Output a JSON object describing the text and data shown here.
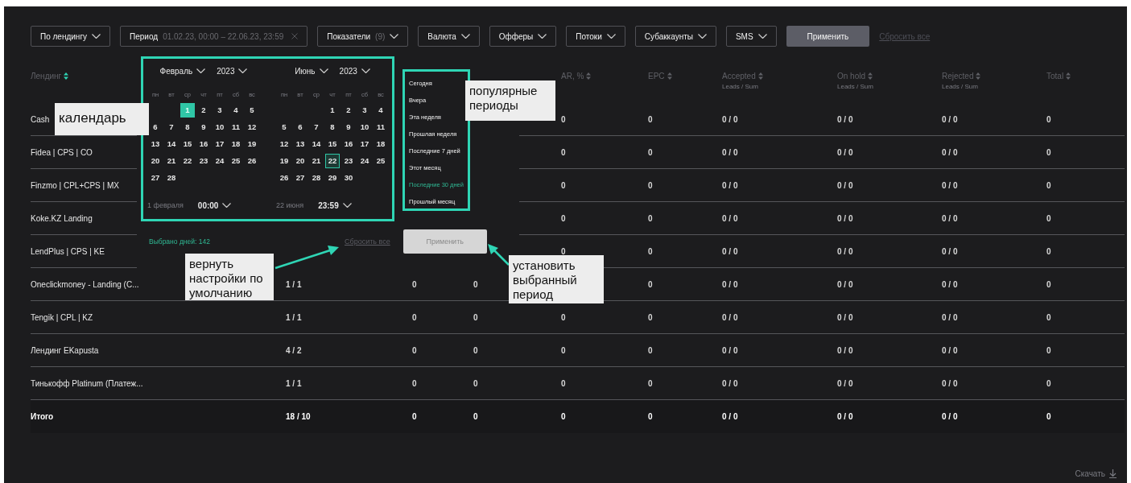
{
  "filters": [
    {
      "kind": "dropdown",
      "label": "По лендингу"
    },
    {
      "kind": "period",
      "label": "Период",
      "value": "01.02.23, 00:00 – 22.06.23, 23:59"
    },
    {
      "kind": "count",
      "label": "Показатели",
      "count": "(9)"
    },
    {
      "kind": "dropdown",
      "label": "Валюта"
    },
    {
      "kind": "dropdown",
      "label": "Офферы"
    },
    {
      "kind": "dropdown",
      "label": "Потоки"
    },
    {
      "kind": "dropdown",
      "label": "Субаккаунты"
    },
    {
      "kind": "dropdown",
      "label": "SMS"
    }
  ],
  "apply_button": "Применить",
  "reset_link": "Сбросить все",
  "table": {
    "columns": [
      {
        "kind": "header",
        "label": "Лендинг",
        "sort_active": true
      },
      {
        "kind": "covered"
      },
      {
        "kind": "covered"
      },
      {
        "kind": "covered"
      },
      {
        "kind": "header",
        "label": "AR, %",
        "sort_active": false
      },
      {
        "kind": "header",
        "label": "EPC",
        "sort_active": false
      },
      {
        "kind": "header",
        "label": "Accepted",
        "sublabel": "Leads / Sum",
        "sort_active": false
      },
      {
        "kind": "header",
        "label": "On hold",
        "sublabel": "Leads / Sum",
        "sort_active": false
      },
      {
        "kind": "header",
        "label": "Rejected",
        "sublabel": "Leads / Sum",
        "sort_active": false
      },
      {
        "kind": "header",
        "label": "Total",
        "sort_active": false
      }
    ],
    "rows": [
      {
        "kind": "full",
        "cells": [
          "Cash",
          "",
          "",
          "",
          "0",
          "0",
          "0 / 0",
          "0 / 0",
          "0 / 0",
          "0"
        ]
      },
      {
        "kind": "full",
        "cells": [
          "Fidea | CPS | CO",
          "",
          "",
          "",
          "0",
          "0",
          "0 / 0",
          "0 / 0",
          "0 / 0",
          "0"
        ]
      },
      {
        "kind": "full",
        "cells": [
          "Finzmo | CPL+CPS | MX",
          "",
          "",
          "",
          "0",
          "0",
          "0 / 0",
          "0 / 0",
          "0 / 0",
          "0"
        ]
      },
      {
        "kind": "full",
        "cells": [
          "Koke.KZ Landing",
          "",
          "",
          "",
          "0",
          "0",
          "0 / 0",
          "0 / 0",
          "0 / 0",
          "0"
        ]
      },
      {
        "kind": "full",
        "cells": [
          "LendPlus | CPS | KE",
          "",
          "",
          "",
          "0",
          "0",
          "0 / 0",
          "0 / 0",
          "0 / 0",
          "0"
        ]
      },
      {
        "kind": "full",
        "cells": [
          "Oneclickmoney - Landing (C...",
          "1 / 1",
          "0",
          "0",
          "",
          "0",
          "0 / 0",
          "0 / 0",
          "0 / 0",
          "0"
        ]
      },
      {
        "kind": "full",
        "cells": [
          "Tengik | CPL | KZ",
          "1 / 1",
          "0",
          "0",
          "0",
          "0",
          "0 / 0",
          "0 / 0",
          "0 / 0",
          "0"
        ]
      },
      {
        "kind": "full",
        "cells": [
          "Лендинг EKapusta",
          "4 / 2",
          "0",
          "0",
          "0",
          "0",
          "0 / 0",
          "0 / 0",
          "0 / 0",
          "0"
        ]
      },
      {
        "kind": "full",
        "cells": [
          "Тинькофф Platinum (Платеж...",
          "1 / 1",
          "0",
          "0",
          "0",
          "0",
          "0 / 0",
          "0 / 0",
          "0 / 0",
          "0"
        ]
      },
      {
        "kind": "total",
        "cells": [
          "Итого",
          "18 / 10",
          "0",
          "0",
          "0",
          "0",
          "0 / 0",
          "0 / 0",
          "0 / 0",
          "0"
        ]
      }
    ]
  },
  "date_picker": {
    "months": [
      {
        "month": "Февраль",
        "year": "2023",
        "first_week_starts_midweek": true,
        "weekdays": [
          "пн",
          "вт",
          "ср",
          "чт",
          "пт",
          "сб",
          "вс"
        ],
        "weeks": [
          {
            "days": [
              {
                "d": "1",
                "selected": true,
                "today": false
              },
              {
                "d": "2",
                "selected": false,
                "today": false
              },
              {
                "d": "3",
                "selected": false,
                "today": false
              },
              {
                "d": "4",
                "selected": false,
                "today": false
              },
              {
                "d": "5",
                "selected": false,
                "today": false
              }
            ]
          },
          {
            "days": [
              {
                "d": "6",
                "selected": false,
                "today": false
              },
              {
                "d": "7",
                "selected": false,
                "today": false
              },
              {
                "d": "8",
                "selected": false,
                "today": false
              },
              {
                "d": "9",
                "selected": false,
                "today": false
              },
              {
                "d": "10",
                "selected": false,
                "today": false
              },
              {
                "d": "11",
                "selected": false,
                "today": false
              },
              {
                "d": "12",
                "selected": false,
                "today": false
              }
            ]
          },
          {
            "days": [
              {
                "d": "13",
                "selected": false,
                "today": false
              },
              {
                "d": "14",
                "selected": false,
                "today": false
              },
              {
                "d": "15",
                "selected": false,
                "today": false
              },
              {
                "d": "16",
                "selected": false,
                "today": false
              },
              {
                "d": "17",
                "selected": false,
                "today": false
              },
              {
                "d": "18",
                "selected": false,
                "today": false
              },
              {
                "d": "19",
                "selected": false,
                "today": false
              }
            ]
          },
          {
            "days": [
              {
                "d": "20",
                "selected": false,
                "today": false
              },
              {
                "d": "21",
                "selected": false,
                "today": false
              },
              {
                "d": "22",
                "selected": false,
                "today": false
              },
              {
                "d": "23",
                "selected": false,
                "today": false
              },
              {
                "d": "24",
                "selected": false,
                "today": false
              },
              {
                "d": "25",
                "selected": false,
                "today": false
              },
              {
                "d": "26",
                "selected": false,
                "today": false
              }
            ]
          },
          {
            "days": [
              {
                "d": "27",
                "selected": false,
                "today": false
              },
              {
                "d": "28",
                "selected": false,
                "today": false
              }
            ]
          }
        ],
        "date": "1 февраля",
        "time": "00:00"
      },
      {
        "month": "Июнь",
        "year": "2023",
        "first_week_starts_midweek": true,
        "weekdays": [
          "пн",
          "вт",
          "ср",
          "чт",
          "пт",
          "сб",
          "вс"
        ],
        "weeks": [
          {
            "days": [
              {
                "d": "1",
                "selected": false,
                "today": false
              },
              {
                "d": "2",
                "selected": false,
                "today": false
              },
              {
                "d": "3",
                "selected": false,
                "today": false
              },
              {
                "d": "4",
                "selected": false,
                "today": false
              }
            ]
          },
          {
            "days": [
              {
                "d": "5",
                "selected": false,
                "today": false
              },
              {
                "d": "6",
                "selected": false,
                "today": false
              },
              {
                "d": "7",
                "selected": false,
                "today": false
              },
              {
                "d": "8",
                "selected": false,
                "today": false
              },
              {
                "d": "9",
                "selected": false,
                "today": false
              },
              {
                "d": "10",
                "selected": false,
                "today": false
              },
              {
                "d": "11",
                "selected": false,
                "today": false
              }
            ]
          },
          {
            "days": [
              {
                "d": "12",
                "selected": false,
                "today": false
              },
              {
                "d": "13",
                "selected": false,
                "today": false
              },
              {
                "d": "14",
                "selected": false,
                "today": false
              },
              {
                "d": "15",
                "selected": false,
                "today": false
              },
              {
                "d": "16",
                "selected": false,
                "today": false
              },
              {
                "d": "17",
                "selected": false,
                "today": false
              },
              {
                "d": "18",
                "selected": false,
                "today": false
              }
            ]
          },
          {
            "days": [
              {
                "d": "19",
                "selected": false,
                "today": false
              },
              {
                "d": "20",
                "selected": false,
                "today": false
              },
              {
                "d": "21",
                "selected": false,
                "today": false
              },
              {
                "d": "22",
                "selected": false,
                "today": true
              },
              {
                "d": "23",
                "selected": false,
                "today": false
              },
              {
                "d": "24",
                "selected": false,
                "today": false
              },
              {
                "d": "25",
                "selected": false,
                "today": false
              }
            ]
          },
          {
            "days": [
              {
                "d": "26",
                "selected": false,
                "today": false
              },
              {
                "d": "27",
                "selected": false,
                "today": false
              },
              {
                "d": "28",
                "selected": false,
                "today": false
              },
              {
                "d": "29",
                "selected": false,
                "today": false
              },
              {
                "d": "30",
                "selected": false,
                "today": false
              }
            ]
          }
        ],
        "date": "22 июня",
        "time": "23:59"
      }
    ],
    "presets": [
      {
        "label": "Сегодня",
        "selected": false
      },
      {
        "label": "Вчера",
        "selected": false
      },
      {
        "label": "Эта неделя",
        "selected": false
      },
      {
        "label": "Прошлая неделя",
        "selected": false
      },
      {
        "label": "Последние 7 дней",
        "selected": false
      },
      {
        "label": "Этот месяц",
        "selected": false
      },
      {
        "label": "Последние 30 дней",
        "selected": true
      },
      {
        "label": "Прошлый месяц",
        "selected": false
      }
    ],
    "days_selected": "Выбрано дней: 142",
    "reset_link": "Сбросить все",
    "apply_button": "Применить"
  },
  "annotations": [
    {
      "text": "календарь"
    },
    {
      "text": "популярные периоды"
    },
    {
      "text": "вернуть настройки по умолчанию"
    },
    {
      "text": "установить выбранный период"
    }
  ],
  "download_link": "Скачать"
}
